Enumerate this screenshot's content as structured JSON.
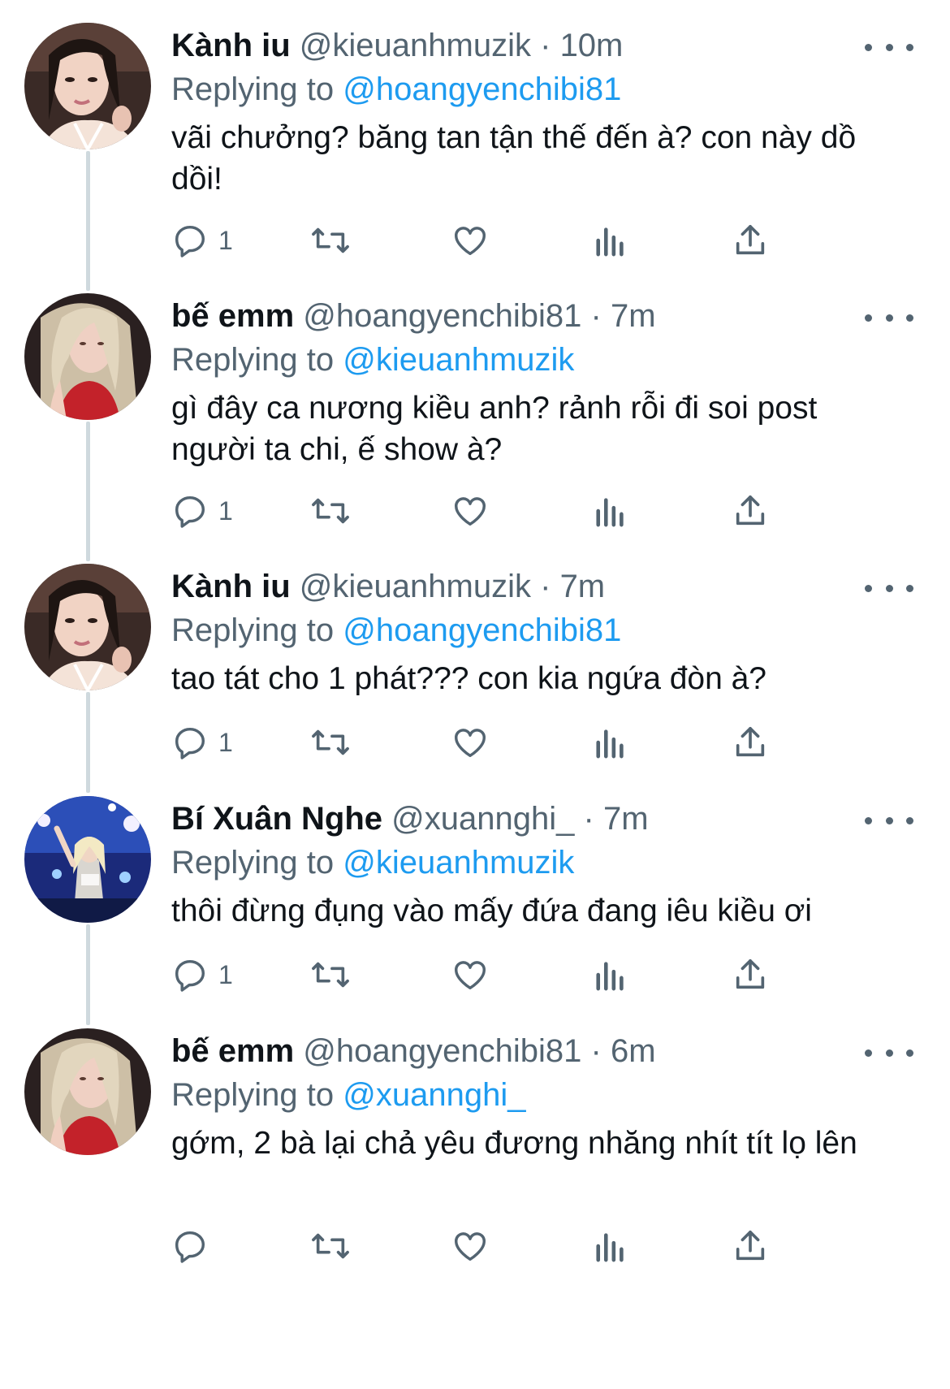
{
  "colors": {
    "accent": "#1d9bf0",
    "secondary_text": "#536471",
    "primary_text": "#0f1419",
    "thread_line": "#cfd9de"
  },
  "tweets": [
    {
      "display_name": "Kành iu",
      "handle": "@kieuanhmuzik",
      "separator": "·",
      "time": "10m",
      "replying_label": "Replying to",
      "replying_to": "@hoangyenchibi81",
      "text": "vãi chưởng? băng tan tận thế đến à? con này dồ dồi!",
      "reply_count": "1",
      "avatar": "avatar-kieuanhmuzik"
    },
    {
      "display_name": "bế emm",
      "handle": "@hoangyenchibi81",
      "separator": "·",
      "time": "7m",
      "replying_label": "Replying to",
      "replying_to": "@kieuanhmuzik",
      "text": "gì đây ca nương kiều anh? rảnh rỗi đi soi post người ta chi, ế show à?",
      "reply_count": "1",
      "avatar": "avatar-hoangyenchibi81"
    },
    {
      "display_name": "Kành iu",
      "handle": "@kieuanhmuzik",
      "separator": "·",
      "time": "7m",
      "replying_label": "Replying to",
      "replying_to": "@hoangyenchibi81",
      "text": "tao tát cho 1 phát??? con kia ngứa đòn à?",
      "reply_count": "1",
      "avatar": "avatar-kieuanhmuzik"
    },
    {
      "display_name": "Bí Xuân Nghe",
      "handle": "@xuannghi_",
      "separator": "·",
      "time": "7m",
      "replying_label": "Replying to",
      "replying_to": "@kieuanhmuzik",
      "text": "thôi đừng đụng vào mấy đứa đang iêu kiều ơi",
      "reply_count": "1",
      "avatar": "avatar-xuannghi"
    },
    {
      "display_name": "bế emm",
      "handle": "@hoangyenchibi81",
      "separator": "·",
      "time": "6m",
      "replying_label": "Replying to",
      "replying_to": "@xuannghi_",
      "text": "gớm, 2 bà lại chả yêu đương nhăng nhít tít lọ lên",
      "reply_count": "",
      "avatar": "avatar-hoangyenchibi81"
    }
  ]
}
